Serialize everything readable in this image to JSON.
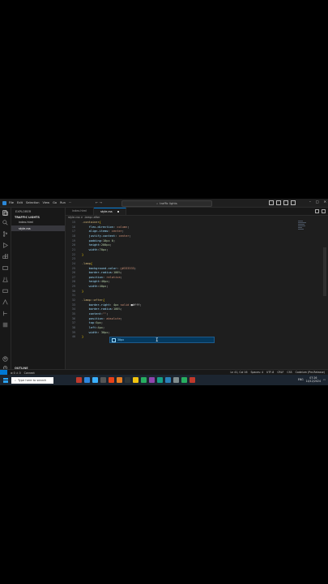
{
  "window": {
    "title_search": "traffic lights",
    "menu": [
      "File",
      "Edit",
      "Selection",
      "View",
      "Go",
      "Run",
      "···"
    ],
    "nav": "←  →",
    "controls": [
      "–",
      "□",
      "✕"
    ]
  },
  "sidebar": {
    "header": "EXPLORER",
    "project": "TRAFFIC LIGHTS",
    "files": [
      {
        "label": "index.html",
        "active": false
      },
      {
        "label": "style.css",
        "active": true
      }
    ],
    "outline": "OUTLINE",
    "timeline": "TIMELINE"
  },
  "tabs": [
    {
      "label": "index.html",
      "active": false
    },
    {
      "label": "style.css",
      "active": true,
      "dirty": true
    }
  ],
  "breadcrumb": "style.css > .lamp::after",
  "code_lines": [
    {
      "ln": "15",
      "parts": [
        [
          "sel",
          ".container"
        ],
        [
          "bracket",
          "{"
        ]
      ]
    },
    {
      "ln": "16",
      "parts": [
        [
          "prop",
          "    flex-direction"
        ],
        [
          "pun",
          ": "
        ],
        [
          "val",
          "column"
        ],
        [
          "pun",
          ";"
        ]
      ]
    },
    {
      "ln": "17",
      "parts": [
        [
          "prop",
          "    align-items"
        ],
        [
          "pun",
          ": "
        ],
        [
          "val",
          "center"
        ],
        [
          "pun",
          ";"
        ]
      ]
    },
    {
      "ln": "18",
      "parts": [
        [
          "prop",
          "    justify-content"
        ],
        [
          "pun",
          ": "
        ],
        [
          "val",
          "center"
        ],
        [
          "pun",
          ";"
        ]
      ]
    },
    {
      "ln": "19",
      "parts": [
        [
          "prop",
          "    padding"
        ],
        [
          "pun",
          ":"
        ],
        [
          "num",
          "10px 0"
        ],
        [
          "pun",
          ";"
        ]
      ]
    },
    {
      "ln": "20",
      "parts": [
        [
          "prop",
          "    height"
        ],
        [
          "pun",
          ":"
        ],
        [
          "num",
          "200px"
        ],
        [
          "pun",
          ";"
        ]
      ]
    },
    {
      "ln": "21",
      "parts": [
        [
          "prop",
          "    width"
        ],
        [
          "pun",
          ":"
        ],
        [
          "num",
          "70px"
        ],
        [
          "pun",
          ";"
        ]
      ]
    },
    {
      "ln": "22",
      "parts": [
        [
          "bracket",
          "}"
        ]
      ]
    },
    {
      "ln": "23",
      "parts": []
    },
    {
      "ln": "24",
      "parts": [
        [
          "sel",
          ".lamp"
        ],
        [
          "bracket",
          "{"
        ]
      ]
    },
    {
      "ln": "25",
      "parts": [
        [
          "prop",
          "    background-color"
        ],
        [
          "pun",
          ": "
        ],
        [
          "val",
          "□#333333"
        ],
        [
          "pun",
          ";"
        ]
      ]
    },
    {
      "ln": "26",
      "parts": [
        [
          "prop",
          "    border-radius"
        ],
        [
          "pun",
          ":"
        ],
        [
          "num",
          "100%"
        ],
        [
          "pun",
          ";"
        ]
      ]
    },
    {
      "ln": "27",
      "parts": [
        [
          "prop",
          "    position"
        ],
        [
          "pun",
          ": "
        ],
        [
          "val",
          "relative"
        ],
        [
          "pun",
          ";"
        ]
      ]
    },
    {
      "ln": "28",
      "parts": [
        [
          "prop",
          "    height"
        ],
        [
          "pun",
          ":"
        ],
        [
          "num",
          "40px"
        ],
        [
          "pun",
          ";"
        ]
      ]
    },
    {
      "ln": "29",
      "parts": [
        [
          "prop",
          "    width"
        ],
        [
          "pun",
          ":"
        ],
        [
          "num",
          "40px"
        ],
        [
          "pun",
          ";"
        ]
      ]
    },
    {
      "ln": "30",
      "parts": [
        [
          "bracket",
          "}"
        ]
      ]
    },
    {
      "ln": "31",
      "parts": []
    },
    {
      "ln": "32",
      "parts": [
        [
          "sel",
          ".lamp::after"
        ],
        [
          "bracket",
          "{"
        ]
      ]
    },
    {
      "ln": "33",
      "parts": [
        [
          "prop",
          "    border-right"
        ],
        [
          "pun",
          ": "
        ],
        [
          "num",
          "4px"
        ],
        [
          "val",
          " solid "
        ],
        [
          "pun",
          "■#fff"
        ],
        [
          "pun",
          ";"
        ]
      ]
    },
    {
      "ln": "34",
      "parts": [
        [
          "prop",
          "    border-radius"
        ],
        [
          "pun",
          ":"
        ],
        [
          "num",
          "100%"
        ],
        [
          "pun",
          ";"
        ]
      ]
    },
    {
      "ln": "35",
      "parts": [
        [
          "prop",
          "    content"
        ],
        [
          "pun",
          ":"
        ],
        [
          "val",
          "\"\""
        ],
        [
          "pun",
          ";"
        ]
      ]
    },
    {
      "ln": "36",
      "parts": [
        [
          "prop",
          "    position"
        ],
        [
          "pun",
          ": "
        ],
        [
          "val",
          "absolute"
        ],
        [
          "pun",
          ";"
        ]
      ]
    },
    {
      "ln": "37",
      "parts": [
        [
          "prop",
          "    top"
        ],
        [
          "pun",
          ":"
        ],
        [
          "num",
          "5px"
        ],
        [
          "pun",
          ";"
        ]
      ]
    },
    {
      "ln": "38",
      "parts": [
        [
          "prop",
          "    left"
        ],
        [
          "pun",
          ":"
        ],
        [
          "num",
          "4px"
        ],
        [
          "pun",
          ";"
        ]
      ]
    },
    {
      "ln": "39",
      "parts": [
        [
          "prop",
          "    width"
        ],
        [
          "pun",
          ": "
        ],
        [
          "num",
          "30px"
        ],
        [
          "pun",
          ";"
        ]
      ]
    },
    {
      "ln": "40",
      "parts": [
        [
          "bracket",
          "}"
        ]
      ]
    }
  ],
  "suggestion": "30px",
  "statusbar": {
    "left": [
      "⊗ 0 ⚠ 0",
      "Connect"
    ],
    "right": [
      "Ln 41, Col 16",
      "Spaces: 4",
      "UTF-8",
      "CRLF",
      "CSS",
      "Codeium (Pre-Release)"
    ]
  },
  "taskbar": {
    "search_placeholder": "Type here to search",
    "time": "07:26",
    "date": "14/12/2024",
    "lang": "ENG"
  },
  "colors": {
    "accent": "#0078d4",
    "editor_bg": "#1e1e1e",
    "sidebar_bg": "#181818"
  }
}
